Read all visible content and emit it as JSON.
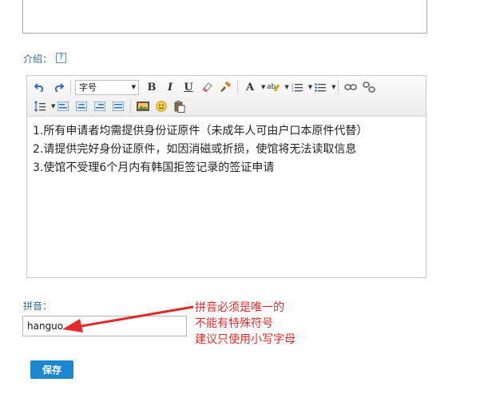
{
  "intro": {
    "label": "介绍：",
    "help": "?"
  },
  "toolbar": {
    "fontsize_value": "字号",
    "bold": "B",
    "italic": "I",
    "underline": "U",
    "forecolor": "A"
  },
  "editor": {
    "lines": [
      "1.所有申请者均需提供身份证原件（未成年人可由户口本原件代替）",
      "2.请提供完好身份证原件，如因消磁或折损，使馆将无法读取信息",
      "3.使馆不受理6个月内有韩国拒签记录的签证申请"
    ]
  },
  "pinyin": {
    "label": "拼音：",
    "value": "hanguo"
  },
  "annotation": {
    "lines": [
      "拼音必须是唯一的",
      "不能有特殊符号",
      "建议只使用小写字母"
    ],
    "color": "#e02b2b"
  },
  "save": {
    "label": "保存",
    "color": "#1d86d1"
  }
}
